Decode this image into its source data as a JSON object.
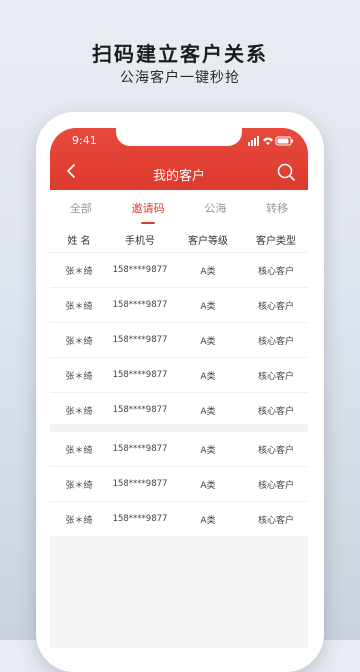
{
  "promo": {
    "title": "扫码建立客户关系",
    "subtitle": "公海客户一键秒抢"
  },
  "status_bar": {
    "time": "9:41"
  },
  "nav": {
    "title": "我的客户",
    "back_icon": "chevron-left-icon",
    "search_icon": "search-icon"
  },
  "tabs": [
    {
      "label": "全部",
      "active": false
    },
    {
      "label": "邀请码",
      "active": true
    },
    {
      "label": "公海",
      "active": false
    },
    {
      "label": "转移",
      "active": false
    }
  ],
  "table": {
    "headers": [
      "姓 名",
      "手机号",
      "客户等级",
      "客户类型"
    ],
    "group1": [
      [
        "张＊绮",
        "158****9877",
        "A类",
        "核心客户"
      ],
      [
        "张＊绮",
        "158****9877",
        "A类",
        "核心客户"
      ],
      [
        "张＊绮",
        "158****9877",
        "A类",
        "核心客户"
      ],
      [
        "张＊绮",
        "158****9877",
        "A类",
        "核心客户"
      ],
      [
        "张＊绮",
        "158****9877",
        "A类",
        "核心客户"
      ]
    ],
    "group2": [
      [
        "张＊绮",
        "158****9877",
        "A类",
        "核心客户"
      ],
      [
        "张＊绮",
        "158****9877",
        "A类",
        "核心客户"
      ],
      [
        "张＊绮",
        "158****9877",
        "A类",
        "核心客户"
      ]
    ]
  },
  "colors": {
    "accent": "#e23b2f",
    "header": "#e84a3c"
  }
}
